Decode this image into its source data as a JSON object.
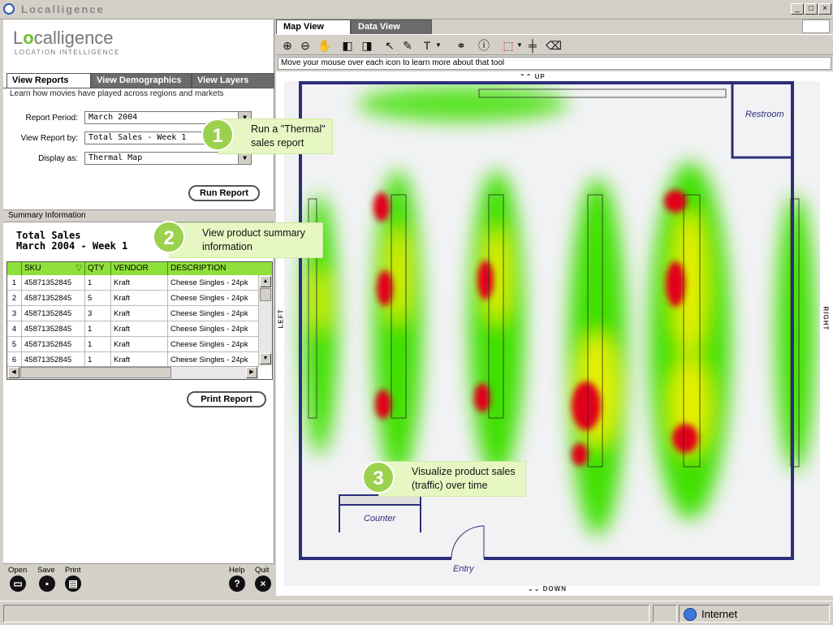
{
  "window": {
    "title": "Localligence"
  },
  "brand": {
    "logo_pre": "L",
    "logo_o": "o",
    "logo_post": "calligence",
    "tagline": "LOCATION INTELLIGENCE"
  },
  "left": {
    "tabs": [
      "View Reports",
      "View Demographics",
      "View Layers"
    ],
    "tab_description": "Learn how movies have played across regions and markets",
    "fields": {
      "report_period_label": "Report Period:",
      "report_period_value": "March 2004",
      "view_by_label": "View Report by:",
      "view_by_value": "Total Sales - Week 1",
      "display_label": "Display as:",
      "display_value": "Thermal Map"
    },
    "run_report": "Run Report",
    "summary_header": "Summary Information",
    "summary_title_1": "Total Sales",
    "summary_title_2": "March 2004 - Week 1",
    "grid": {
      "columns": [
        "SKU",
        "QTY",
        "VENDOR",
        "DESCRIPTION"
      ],
      "rows": [
        {
          "n": "1",
          "sku": "45871352845",
          "qty": "1",
          "vendor": "Kraft",
          "desc": "Cheese Singles - 24pk"
        },
        {
          "n": "2",
          "sku": "45871352845",
          "qty": "5",
          "vendor": "Kraft",
          "desc": "Cheese Singles - 24pk"
        },
        {
          "n": "3",
          "sku": "45871352845",
          "qty": "3",
          "vendor": "Kraft",
          "desc": "Cheese Singles - 24pk"
        },
        {
          "n": "4",
          "sku": "45871352845",
          "qty": "1",
          "vendor": "Kraft",
          "desc": "Cheese Singles - 24pk"
        },
        {
          "n": "5",
          "sku": "45871352845",
          "qty": "1",
          "vendor": "Kraft",
          "desc": "Cheese Singles - 24pk"
        },
        {
          "n": "6",
          "sku": "45871352845",
          "qty": "1",
          "vendor": "Kraft",
          "desc": "Cheese Singles - 24pk"
        }
      ]
    },
    "print_report": "Print Report",
    "tools": {
      "open": "Open",
      "save": "Save",
      "print": "Print",
      "help": "Help",
      "quit": "Quit"
    }
  },
  "callouts": {
    "c1_num": "1",
    "c1_l1": "Run a \"Thermal\"",
    "c1_l2": "sales report",
    "c2_num": "2",
    "c2_l1": "View product summary",
    "c2_l2": "information",
    "c3_num": "3",
    "c3_l1": "Visualize product sales",
    "c3_l2": "(traffic) over time"
  },
  "map": {
    "tabs": [
      "Map View",
      "Data View"
    ],
    "hint": "Move your mouse over each icon to learn more about that tool",
    "dirs": {
      "up": "UP",
      "down": "DOWN",
      "left": "LEFT",
      "right": "RIGHT"
    },
    "labels": {
      "restroom": "Restroom",
      "counter": "Counter",
      "entry": "Entry"
    }
  },
  "status": {
    "zone": "Internet"
  }
}
